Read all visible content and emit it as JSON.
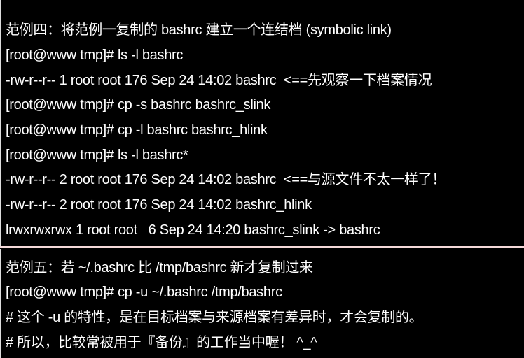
{
  "example4": {
    "lines": [
      "范例四：将范例一复制的 bashrc 建立一个连结档 (symbolic link)",
      "[root@www tmp]# ls -l bashrc",
      "-rw-r--r-- 1 root root 176 Sep 24 14:02 bashrc  <==先观察一下档案情况",
      "[root@www tmp]# cp -s bashrc bashrc_slink",
      "[root@www tmp]# cp -l bashrc bashrc_hlink",
      "[root@www tmp]# ls -l bashrc*",
      "-rw-r--r-- 2 root root 176 Sep 24 14:02 bashrc  <==与源文件不太一样了！",
      "-rw-r--r-- 2 root root 176 Sep 24 14:02 bashrc_hlink",
      "lrwxrwxrwx 1 root root   6 Sep 24 14:20 bashrc_slink -> bashrc"
    ]
  },
  "example5": {
    "lines": [
      "范例五：若 ~/.bashrc 比 /tmp/bashrc 新才复制过来",
      "[root@www tmp]# cp -u ~/.bashrc /tmp/bashrc",
      "# 这个 -u 的特性，是在目标档案与来源档案有差异时，才会复制的。",
      "# 所以，比较常被用于『备份』的工作当中喔！ ^_^"
    ]
  }
}
